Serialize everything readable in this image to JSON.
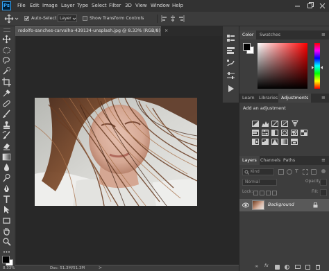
{
  "app": {
    "logo_text": "Ps",
    "brand_color": "#31a8ff"
  },
  "menu": [
    "File",
    "Edit",
    "Image",
    "Layer",
    "Type",
    "Select",
    "Filter",
    "3D",
    "View",
    "Window",
    "Help"
  ],
  "options_bar": {
    "auto_select_label": "Auto-Select",
    "auto_select_checked": true,
    "auto_select_target": "Layer",
    "show_transform_label": "Show Transform Controls",
    "show_transform_checked": false
  },
  "document": {
    "tab_title": "rodolfo-sanches-carvalho-439134-unsplash.jpg @ 8.33% (RGB/8)",
    "close_glyph": "×"
  },
  "status_bar": {
    "zoom": "8.33%",
    "doc_info": "Doc: 51.3M/51.3M"
  },
  "color_panel": {
    "tabs": [
      "Color",
      "Swatches"
    ],
    "active_tab": "Color",
    "foreground": "#000000",
    "background": "#ffffff",
    "field_hue": "#ff0000"
  },
  "adjustments_panel": {
    "tabs": [
      "Learn",
      "Libraries",
      "Adjustments"
    ],
    "active_tab": "Adjustments",
    "heading": "Add an adjustment"
  },
  "layers_panel": {
    "tabs": [
      "Layers",
      "Channels",
      "Paths"
    ],
    "active_tab": "Layers",
    "filter_placeholder": "Kind",
    "blend_mode": "Normal",
    "opacity_label": "Opacity:",
    "lock_label": "Lock:",
    "fill_label": "Fill:",
    "layers": [
      {
        "name": "Background",
        "visible": true,
        "locked": true
      }
    ]
  }
}
